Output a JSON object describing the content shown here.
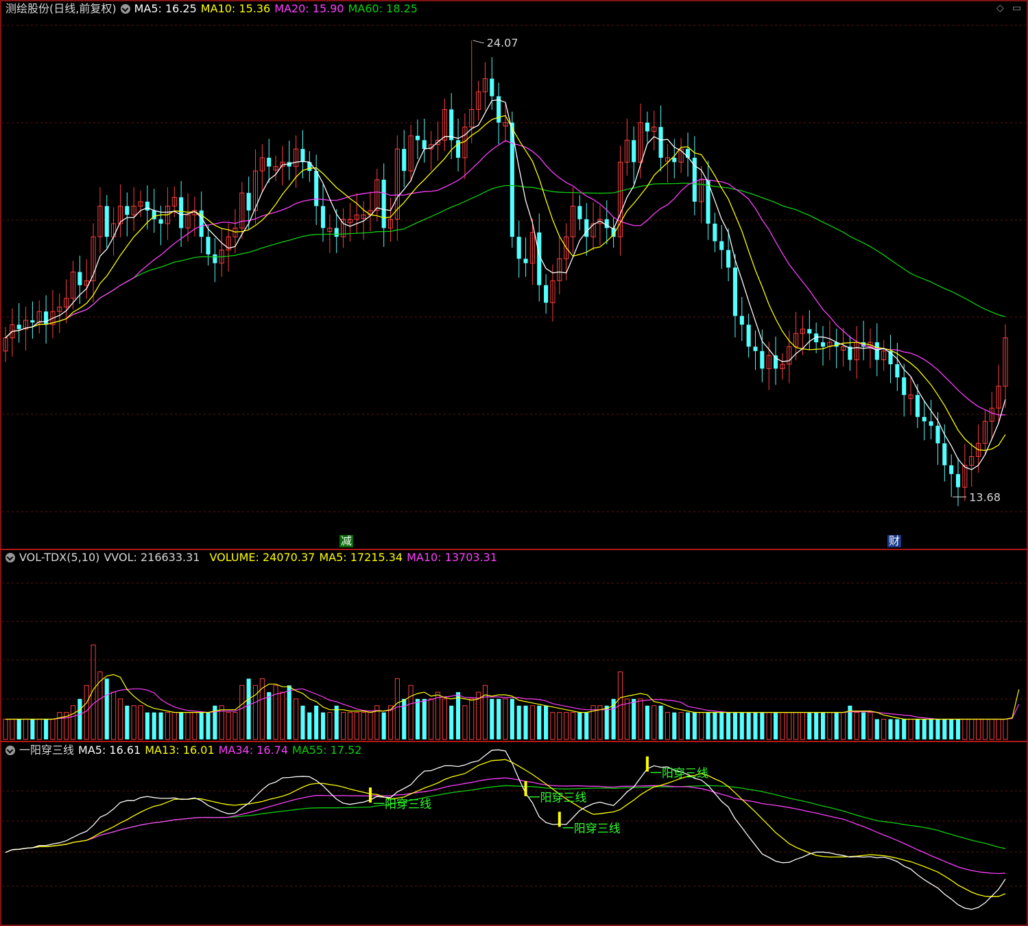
{
  "colors": {
    "bg": "#000000",
    "border": "#b01818",
    "grid": "#6a1414",
    "up": "#ff4040",
    "down": "#54ffff",
    "ma5": "#ffffff",
    "ma10": "#ffff00",
    "ma20": "#ff40ff",
    "ma60": "#10d010",
    "vol_ma5": "#ffff00",
    "vol_ma10": "#ff40ff",
    "signal": "#ffff00",
    "signal_text": "#30ff30",
    "label": "#d8d8d8",
    "minor": "#9a9a9a"
  },
  "main": {
    "title": "测绘股份(日线,前复权)",
    "ma5": "MA5: 16.25",
    "ma10": "MA10: 15.36",
    "ma20": "MA20: 15.90",
    "ma60": "MA60: 18.25",
    "high_label": "24.07",
    "low_label": "13.68",
    "tag_reduce": "减",
    "tag_finance": "财"
  },
  "vol": {
    "name": "VOL-TDX(5,10)",
    "vvol": "VVOL: 216633.31",
    "volume": "VOLUME: 24070.37",
    "ma5": "MA5: 17215.34",
    "ma10": "MA10: 13703.31"
  },
  "ind": {
    "name": "一阳穿三线",
    "ma5": "MA5: 16.61",
    "ma13": "MA13: 16.01",
    "ma34": "MA34: 16.74",
    "ma55": "MA55: 17.52",
    "signal_label": "一阳穿三线"
  },
  "corner_icons": [
    "diamond-icon",
    "window-restore-icon"
  ],
  "chart_data": {
    "type": "candlestick",
    "title": "测绘股份(日线,前复权)",
    "price_range": [
      13.68,
      24.07
    ],
    "key_points": {
      "high": 24.07,
      "low": 13.68
    },
    "ma_values": {
      "MA5": 16.25,
      "MA10": 15.36,
      "MA20": 15.9,
      "MA60": 18.25
    },
    "close": [
      17.3,
      17.6,
      17.5,
      17.7,
      17.65,
      17.9,
      17.6,
      17.9,
      18.0,
      18.2,
      18.8,
      18.5,
      18.6,
      19.6,
      20.3,
      19.6,
      19.9,
      20.3,
      20.1,
      20.3,
      20.4,
      20.2,
      20.0,
      19.9,
      20.3,
      20.5,
      19.8,
      20.1,
      20.2,
      19.6,
      19.2,
      19.0,
      19.3,
      19.6,
      19.8,
      20.6,
      20.2,
      21.1,
      21.4,
      21.2,
      21.2,
      21.3,
      21.2,
      21.6,
      21.3,
      21.1,
      20.3,
      19.8,
      19.8,
      19.6,
      20.0,
      20.0,
      20.1,
      20.1,
      20.2,
      20.9,
      19.8,
      20.0,
      21.6,
      21.1,
      21.9,
      21.8,
      21.6,
      21.7,
      21.8,
      22.5,
      21.8,
      21.4,
      22.1,
      22.5,
      22.9,
      23.2,
      22.8,
      22.2,
      22.2,
      19.6,
      19.1,
      19.0,
      19.7,
      18.5,
      18.1,
      18.6,
      19.1,
      19.6,
      20.3,
      20.0,
      19.6,
      19.9,
      20.0,
      19.8,
      19.6,
      21.3,
      21.8,
      21.3,
      22.2,
      22.0,
      22.1,
      21.4,
      21.4,
      21.3,
      21.6,
      21.4,
      20.4,
      20.9,
      19.9,
      19.5,
      19.3,
      18.9,
      17.8,
      17.6,
      17.1,
      17.0,
      16.6,
      16.9,
      16.6,
      16.7,
      17.1,
      17.4,
      17.5,
      17.4,
      17.2,
      17.1,
      17.2,
      17.1,
      17.1,
      16.8,
      17.2,
      17.1,
      17.2,
      16.8,
      17.0,
      16.7,
      16.4,
      16.0,
      16.0,
      15.5,
      15.4,
      15.3,
      14.9,
      14.4,
      14.2,
      13.9,
      14.4,
      14.6,
      14.9,
      15.4,
      15.7,
      16.2,
      17.3
    ],
    "volume_scale_note": "",
    "volume": [
      3,
      3,
      3,
      3,
      3,
      3,
      3,
      3,
      4,
      4,
      5,
      6,
      8,
      14,
      10,
      9,
      7,
      6,
      5,
      5,
      5,
      4,
      4,
      4,
      4,
      4,
      4,
      4,
      4,
      4,
      4,
      5,
      5,
      4,
      4,
      8,
      9,
      8,
      9,
      7,
      8,
      7,
      8,
      6,
      5,
      4,
      5,
      4,
      4,
      5,
      4,
      4,
      4,
      4,
      4,
      5,
      4,
      5,
      9,
      6,
      8,
      6,
      6,
      6,
      7,
      6,
      5,
      7,
      5,
      6,
      7,
      8,
      6,
      6,
      6,
      6,
      5,
      5,
      5,
      5,
      5,
      4,
      4,
      4,
      4,
      4,
      4,
      5,
      5,
      5,
      6,
      10,
      6,
      6,
      6,
      5,
      5,
      5,
      4,
      4,
      4,
      4,
      4,
      4,
      4,
      4,
      4,
      4,
      4,
      4,
      4,
      4,
      4,
      4,
      4,
      4,
      4,
      4,
      4,
      4,
      4,
      4,
      4,
      4,
      4,
      5,
      4,
      4,
      4,
      3,
      3,
      3,
      3,
      3,
      3,
      3,
      3,
      3,
      3,
      3,
      3,
      3,
      3,
      3,
      3,
      3,
      3,
      3,
      3,
      4,
      24
    ],
    "series": [
      {
        "name": "MA5"
      },
      {
        "name": "MA10"
      },
      {
        "name": "MA20"
      },
      {
        "name": "MA60"
      }
    ],
    "indicator_series": [
      {
        "name": "MA5",
        "last": 16.61
      },
      {
        "name": "MA13",
        "last": 16.01
      },
      {
        "name": "MA34",
        "last": 16.74
      },
      {
        "name": "MA55",
        "last": 17.52
      }
    ],
    "volume_series": [
      {
        "name": "VOLUME",
        "last": 24070.37
      },
      {
        "name": "MA5",
        "last": 17215.34
      },
      {
        "name": "MA10",
        "last": 13703.31
      }
    ],
    "signals": [
      54,
      77,
      82,
      95
    ]
  }
}
